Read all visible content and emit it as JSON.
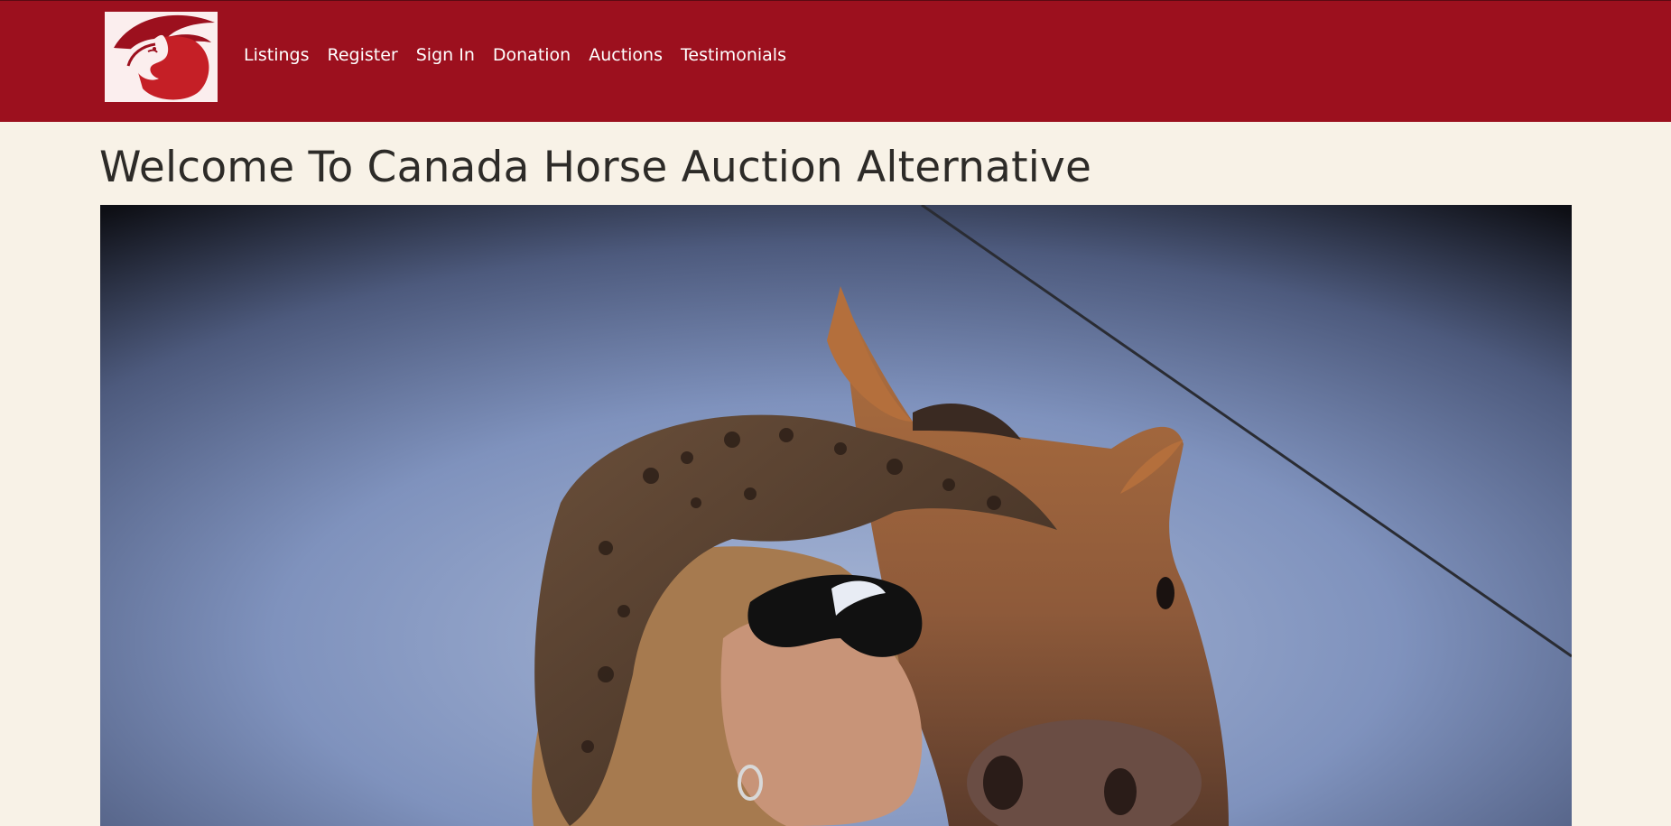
{
  "header": {
    "logo_icon": "horse-head-logo-icon",
    "brand_color": "#9c101e",
    "nav": [
      {
        "label": "Listings"
      },
      {
        "label": "Register"
      },
      {
        "label": "Sign In"
      },
      {
        "label": "Donation"
      },
      {
        "label": "Auctions"
      },
      {
        "label": "Testimonials"
      }
    ]
  },
  "main": {
    "title": "Welcome To Canada Horse Auction Alternative",
    "background_color": "#f8f2e7"
  }
}
